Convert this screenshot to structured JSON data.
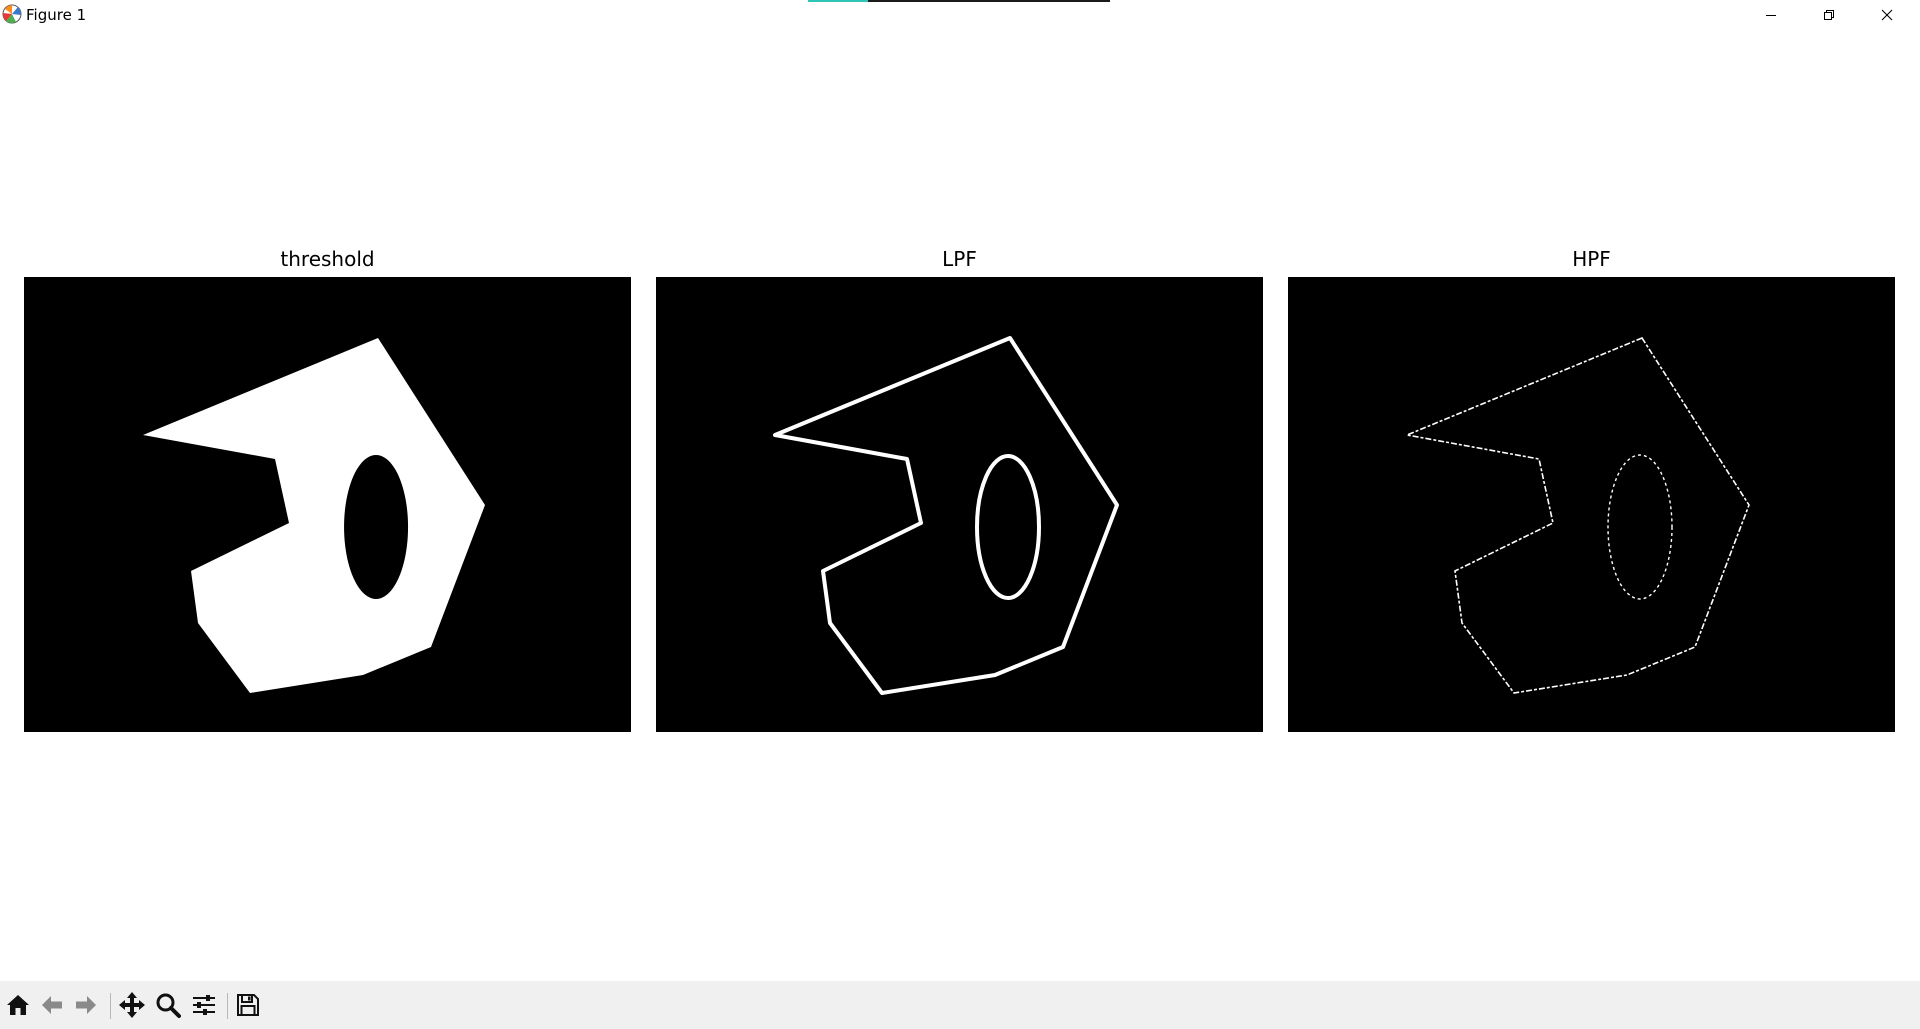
{
  "window": {
    "title": "Figure 1",
    "progress_fraction": 0.2
  },
  "figure": {
    "subplots": [
      {
        "title": "threshold"
      },
      {
        "title": "LPF"
      },
      {
        "title": "HPF"
      }
    ]
  },
  "toolbar": {
    "buttons": [
      {
        "icon": "home-icon"
      },
      {
        "icon": "back-arrow-icon"
      },
      {
        "icon": "forward-arrow-icon"
      },
      {
        "icon": "pan-move-icon"
      },
      {
        "icon": "zoom-magnifier-icon"
      },
      {
        "icon": "configure-subplots-icon"
      },
      {
        "icon": "save-floppy-icon"
      }
    ]
  },
  "colors": {
    "image_background": "#000000",
    "shape_foreground": "#ffffff",
    "toolbar_background": "#f0f0f0",
    "progress_accent": "#2ec4b6"
  }
}
